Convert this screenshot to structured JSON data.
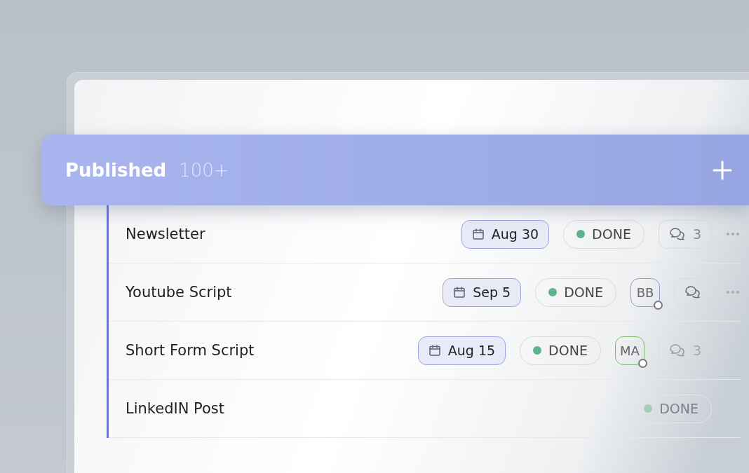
{
  "group": {
    "title": "Published",
    "count": "100+"
  },
  "tasks": [
    {
      "title": "Newsletter",
      "date": "Aug 30",
      "status": {
        "label": "DONE",
        "color": "#5bb48a"
      },
      "comments": {
        "count": "3",
        "faded": false
      },
      "more": true
    },
    {
      "title": "Youtube Script",
      "date": "Sep 5",
      "status": {
        "label": "DONE",
        "color": "#5bb48a"
      },
      "assignee": {
        "initials": "BB",
        "color": "#8f97d6"
      },
      "comments": {
        "faded": false
      },
      "more": true
    },
    {
      "title": "Short Form Script",
      "date": "Aug 15",
      "status": {
        "label": "DONE",
        "color": "#5bb48a"
      },
      "assignee": {
        "initials": "MA",
        "color": "#7dbb6e"
      },
      "comments": {
        "count": "3",
        "faded": true
      },
      "more": false
    },
    {
      "title": "LinkedIN Post",
      "status": {
        "label": "DONE",
        "color": "#a3cfb8"
      },
      "more": false
    }
  ]
}
